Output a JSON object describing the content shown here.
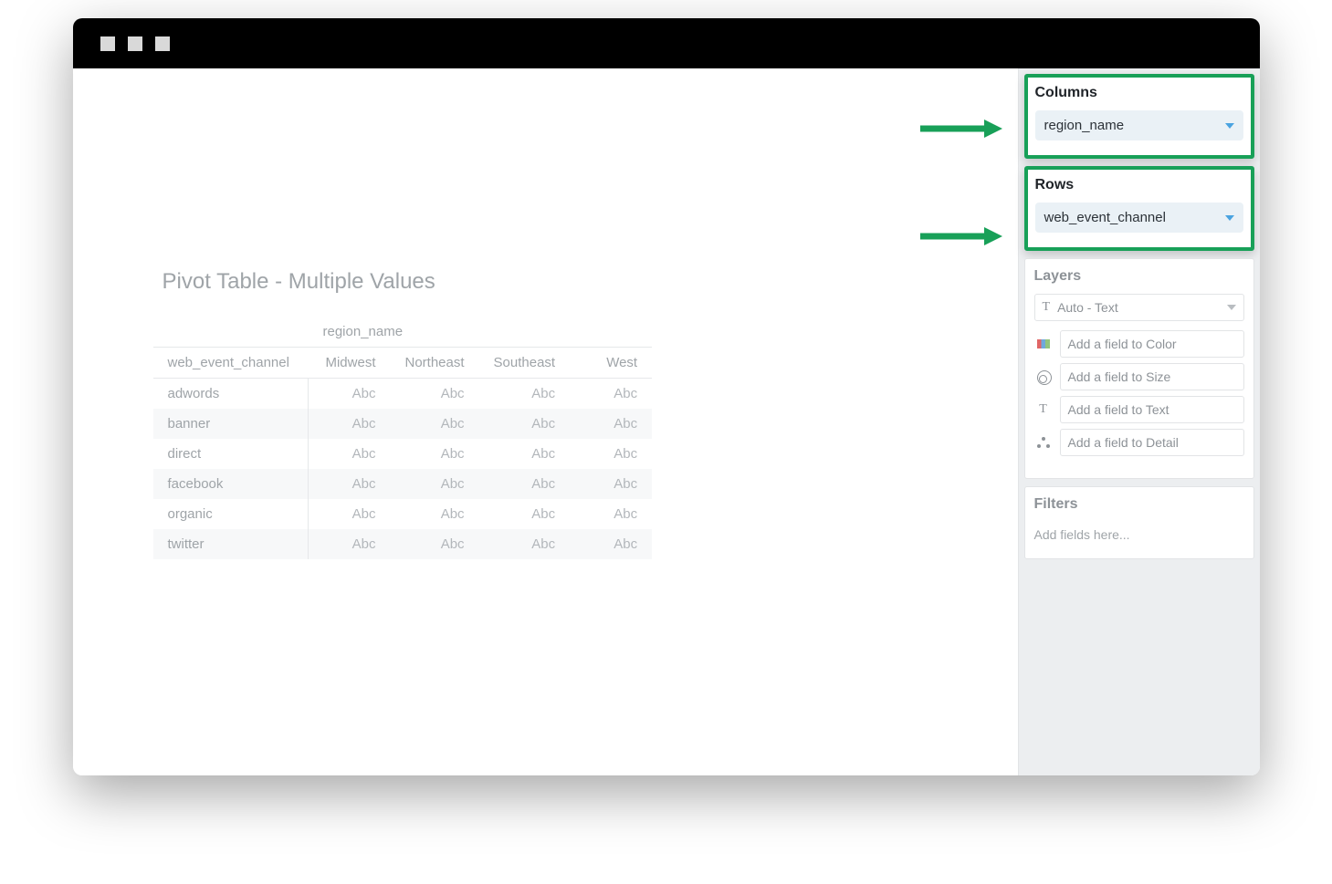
{
  "chart": {
    "title": "Pivot Table - Multiple Values",
    "column_field_label": "region_name",
    "row_field_label": "web_event_channel",
    "columns": [
      "Midwest",
      "Northeast",
      "Southeast",
      "West"
    ],
    "rows": [
      "adwords",
      "banner",
      "direct",
      "facebook",
      "organic",
      "twitter"
    ],
    "cell_value": "Abc"
  },
  "panel": {
    "columns": {
      "title": "Columns",
      "pill": "region_name"
    },
    "rows": {
      "title": "Rows",
      "pill": "web_event_channel"
    },
    "layers": {
      "title": "Layers",
      "mark_select": "Auto - Text",
      "color_placeholder": "Add a field to Color",
      "size_placeholder": "Add a field to Size",
      "text_placeholder": "Add a field to Text",
      "detail_placeholder": "Add a field to Detail"
    },
    "filters": {
      "title": "Filters",
      "placeholder": "Add fields here..."
    }
  },
  "chart_data": {
    "type": "table",
    "title": "Pivot Table - Multiple Values",
    "column_dimension": "region_name",
    "row_dimension": "web_event_channel",
    "columns": [
      "Midwest",
      "Northeast",
      "Southeast",
      "West"
    ],
    "rows": [
      "adwords",
      "banner",
      "direct",
      "facebook",
      "organic",
      "twitter"
    ],
    "values": [
      [
        "Abc",
        "Abc",
        "Abc",
        "Abc"
      ],
      [
        "Abc",
        "Abc",
        "Abc",
        "Abc"
      ],
      [
        "Abc",
        "Abc",
        "Abc",
        "Abc"
      ],
      [
        "Abc",
        "Abc",
        "Abc",
        "Abc"
      ],
      [
        "Abc",
        "Abc",
        "Abc",
        "Abc"
      ],
      [
        "Abc",
        "Abc",
        "Abc",
        "Abc"
      ]
    ]
  }
}
